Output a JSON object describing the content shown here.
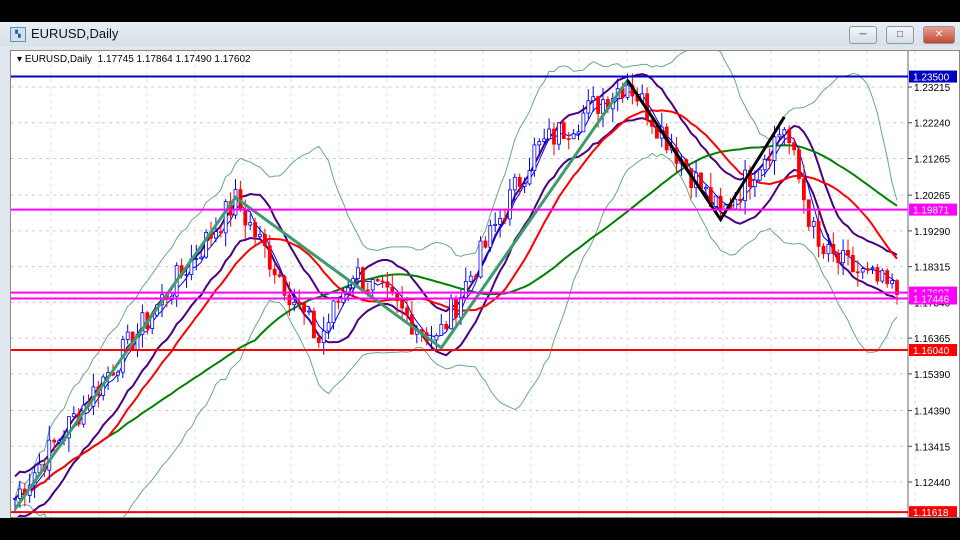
{
  "window": {
    "title": "EURUSD,Daily",
    "buttons": {
      "minimize": "─",
      "maximize": "□",
      "close": "✕"
    }
  },
  "chart_info": {
    "symbol": "EURUSD,Daily",
    "open": "1.17745",
    "high": "1.17864",
    "low": "1.17490",
    "close": "1.17602"
  },
  "chart_data": {
    "type": "candlestick",
    "price_ticks": [
      "1.23215",
      "1.22240",
      "1.21265",
      "1.20265",
      "1.19290",
      "1.18315",
      "1.17340",
      "1.16365",
      "1.15390",
      "1.14390",
      "1.13415",
      "1.12440"
    ],
    "horizontal_lines": [
      {
        "price": 1.235,
        "label": "1.23500",
        "color": "#0000c0"
      },
      {
        "price": 1.19871,
        "label": "1.19871",
        "color": "#ff00ff"
      },
      {
        "price": 1.17607,
        "label": "1.17607",
        "color": "#ff00ff"
      },
      {
        "price": 1.17446,
        "label": "1.17446",
        "color": "#ff00ff"
      },
      {
        "price": 1.1604,
        "label": "1.16040",
        "color": "#ff0000"
      },
      {
        "price": 1.11618,
        "label": "1.11618",
        "color": "#ff0000"
      }
    ],
    "price_path": [
      [
        0,
        1.12
      ],
      [
        1,
        1.122
      ],
      [
        45,
        1.2011
      ],
      [
        62,
        1.1629
      ],
      [
        69,
        1.182
      ],
      [
        86,
        1.1629
      ],
      [
        106,
        1.2147
      ],
      [
        125,
        1.2338
      ],
      [
        144,
        1.197
      ],
      [
        157,
        1.2215
      ],
      [
        164,
        1.1874
      ],
      [
        180,
        1.176
      ]
    ],
    "zigzag_green": [
      [
        0,
        1.117
      ],
      [
        45,
        1.202
      ],
      [
        87,
        1.161
      ],
      [
        125,
        1.234
      ]
    ],
    "zigzag_black": [
      [
        125,
        1.234
      ],
      [
        144,
        1.196
      ],
      [
        157,
        1.224
      ]
    ],
    "colors": {
      "bull": "#0000ff",
      "bear": "#ff0000",
      "ma_fast": "#0000ff",
      "ma_mid": "#ff0000",
      "ma_slow": "#008000",
      "envelope": "#4b0082",
      "bands": "#66aa88"
    }
  }
}
